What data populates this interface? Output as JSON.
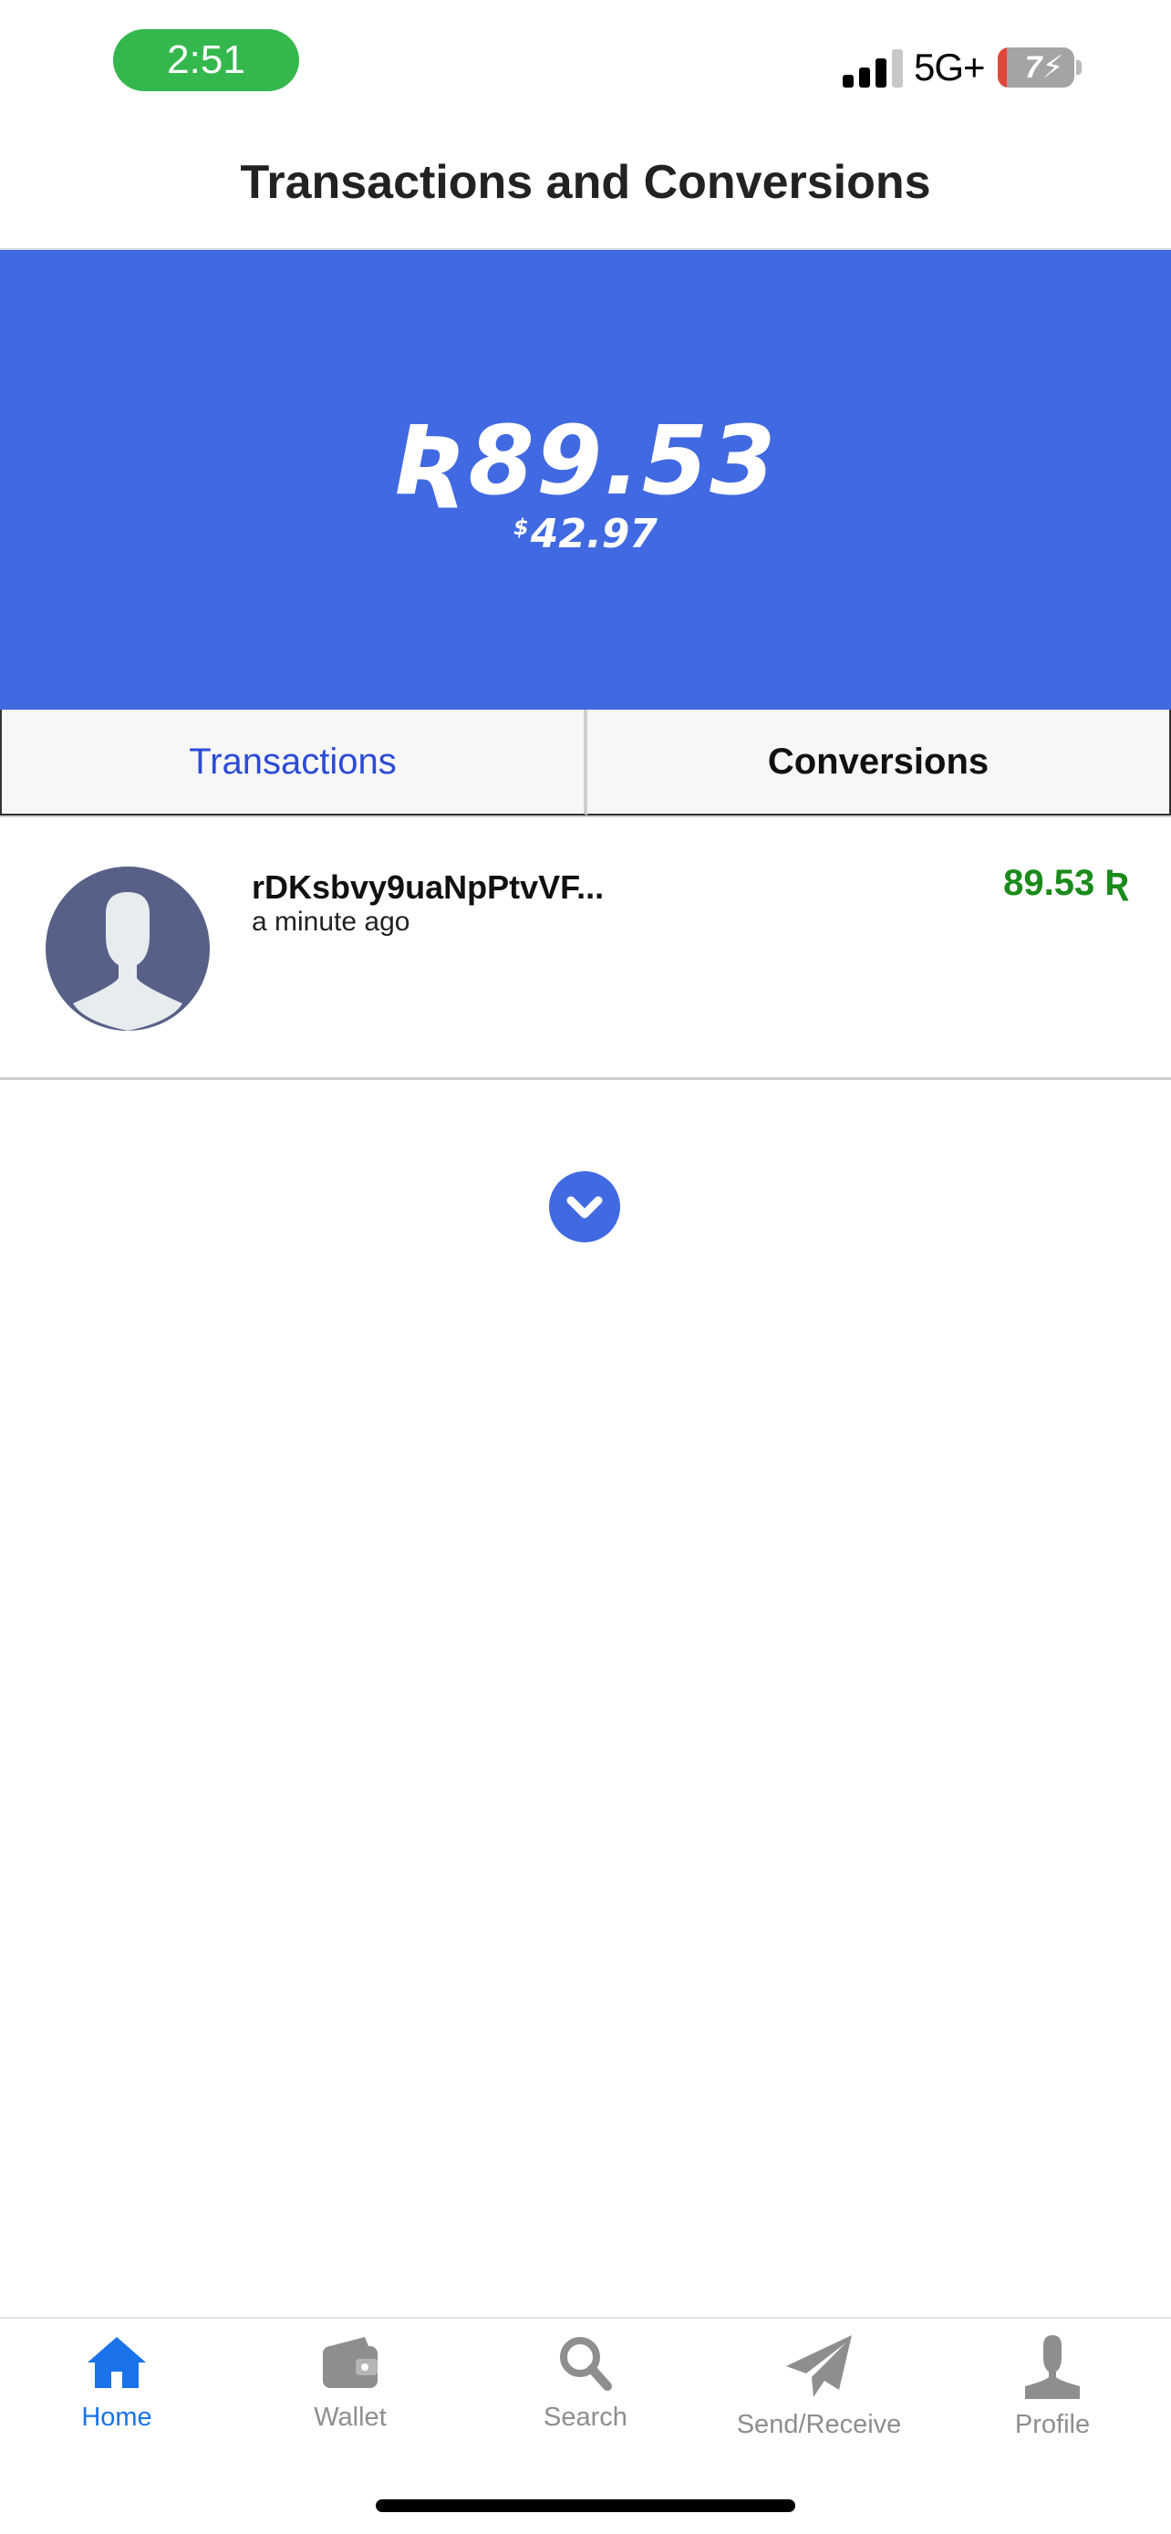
{
  "status_bar": {
    "time": "2:51",
    "network": "5G+",
    "battery_level": "7"
  },
  "header": {
    "title": "Transactions and Conversions"
  },
  "balance": {
    "primary": "Ʀ89.53",
    "usd_symbol": "$",
    "usd_value": "42.97",
    "banner_color": "#4169e1"
  },
  "tabs": [
    {
      "label": "Transactions",
      "active": true
    },
    {
      "label": "Conversions",
      "active": false
    }
  ],
  "transactions": [
    {
      "address": "rDKsbvy9uaNpPtvVF...",
      "time": "a minute ago",
      "amount": "89.53 Ʀ",
      "amount_color": "#1a8a1a",
      "avatar": "default-user-avatar"
    }
  ],
  "load_more": {
    "icon": "chevron-down-icon"
  },
  "nav": [
    {
      "label": "Home",
      "icon": "home-icon",
      "active": true
    },
    {
      "label": "Wallet",
      "icon": "wallet-icon",
      "active": false
    },
    {
      "label": "Search",
      "icon": "search-icon",
      "active": false
    },
    {
      "label": "Send/Receive",
      "icon": "paper-plane-icon",
      "active": false
    },
    {
      "label": "Profile",
      "icon": "user-icon",
      "active": false
    }
  ],
  "colors": {
    "accent": "#4169e1",
    "active_tab_text": "#2c4bd6",
    "nav_active": "#1a73e8",
    "nav_inactive": "#8e8e8e"
  }
}
